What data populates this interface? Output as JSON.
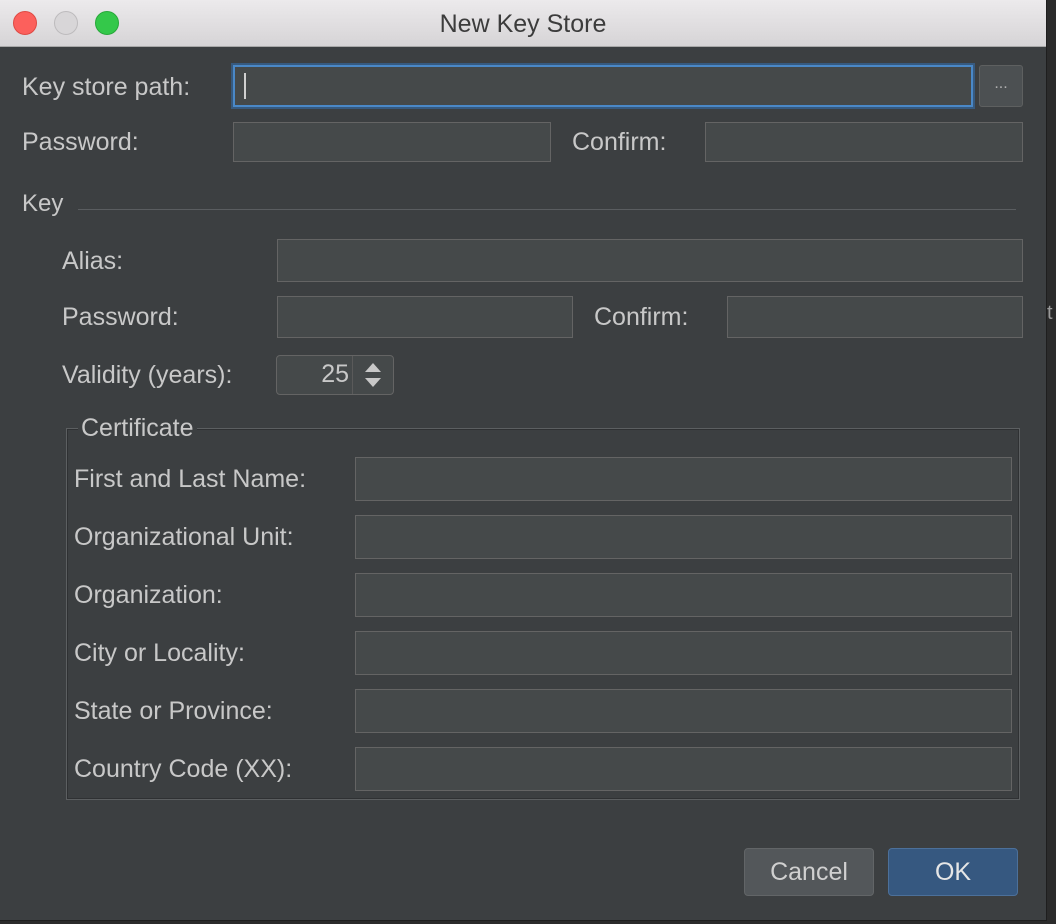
{
  "window": {
    "title": "New Key Store"
  },
  "keystore": {
    "path_label": "Key store path:",
    "path_value": "",
    "browse_label": "...",
    "password_label": "Password:",
    "confirm_label": "Confirm:"
  },
  "key": {
    "section_label": "Key",
    "alias_label": "Alias:",
    "password_label": "Password:",
    "confirm_label": "Confirm:",
    "validity_label": "Validity (years):",
    "validity_value": "25"
  },
  "certificate": {
    "legend": "Certificate",
    "fields": [
      {
        "label": "First and Last Name:"
      },
      {
        "label": "Organizational Unit:"
      },
      {
        "label": "Organization:"
      },
      {
        "label": "City or Locality:"
      },
      {
        "label": "State or Province:"
      },
      {
        "label": "Country Code (XX):"
      }
    ]
  },
  "buttons": {
    "cancel": "Cancel",
    "ok": "OK"
  },
  "offscreen_glyph": "t",
  "colors": {
    "background": "#3c3f41",
    "field_bg": "#45494a",
    "focus_border": "#4a88c7",
    "ok_button": "#365880",
    "text": "#c8c8c8"
  }
}
